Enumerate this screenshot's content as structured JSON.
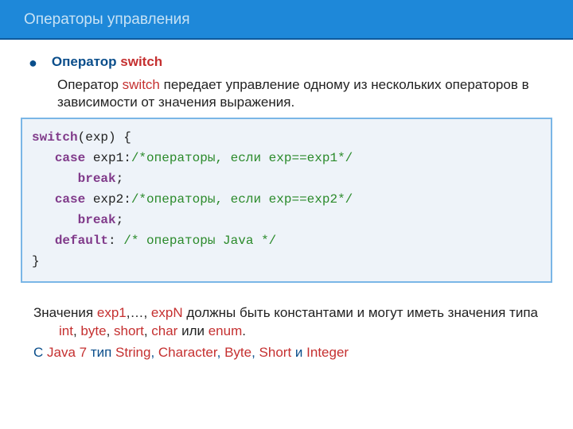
{
  "header": {
    "title": "Операторы управления"
  },
  "bullet": {
    "operator_label": "Оператор ",
    "operator_keyword": "switch"
  },
  "description": {
    "pre": "Оператор ",
    "kw": "switch",
    "post": " передает управление одному из нескольких операторов в зависимости от  значения выражения."
  },
  "code": {
    "l1_kw": "switch",
    "l1_tx": "(exp) {",
    "l2_pad": "   ",
    "l2_kw": "case",
    "l2_tx": " exp1:",
    "l2_cm": "/*операторы, если exp==exp1*/",
    "l3_pad": "      ",
    "l3_kw": "break",
    "l3_tx": ";",
    "l4_pad": "   ",
    "l4_kw": "case",
    "l4_tx": " exp2:",
    "l4_cm": "/*операторы, если exp==exp2*/",
    "l5_pad": "      ",
    "l5_kw": "break",
    "l5_tx": ";",
    "l6_pad": "   ",
    "l6_kw": "default",
    "l6_tx": ": ",
    "l6_cm": "/* операторы Java */",
    "l7_tx": "}"
  },
  "footer": {
    "p1_a": "Значения ",
    "p1_b": "exp1",
    "p1_c": ",…, ",
    "p1_d": "expN",
    "p1_e": " должны быть константами и могут иметь значения типа ",
    "p1_f": "int",
    "p1_g": ", ",
    "p1_h": "byte",
    "p1_i": ", ",
    "p1_j": "short",
    "p1_k": ", ",
    "p1_l": "char",
    "p1_m": " или ",
    "p1_n": "enum",
    "p1_o": ".",
    "p2_a": "С ",
    "p2_b": "Java 7",
    "p2_c": " тип ",
    "p2_d": "String",
    "p2_e": ", ",
    "p2_f": "Character",
    "p2_g": ", ",
    "p2_h": "Byte",
    "p2_i": ", ",
    "p2_j": "Short",
    "p2_k": " и ",
    "p2_l": "Integer"
  }
}
